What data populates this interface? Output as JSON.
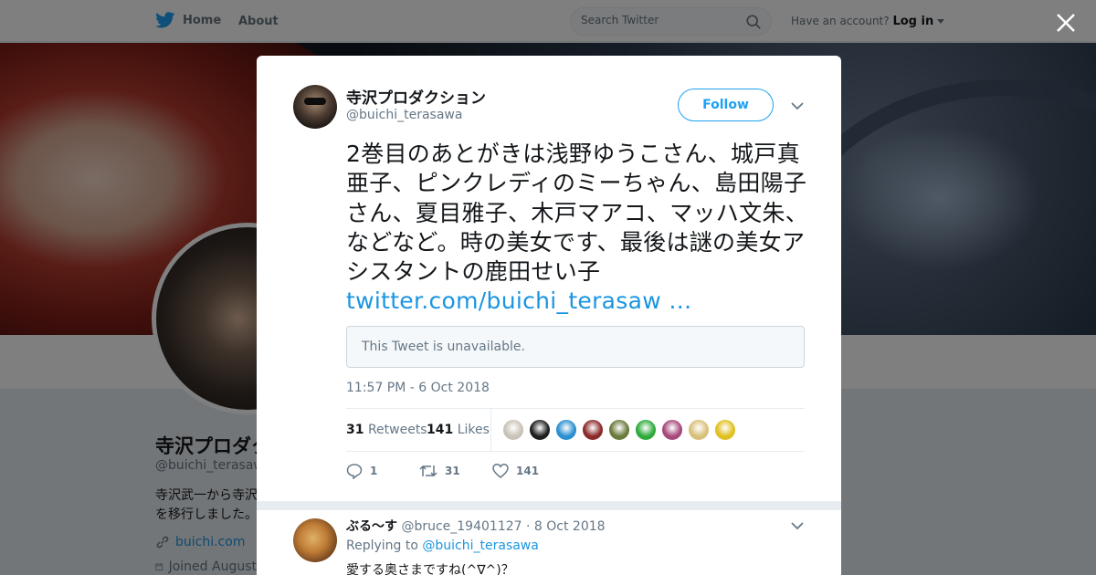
{
  "topbar": {
    "home_label": "Home",
    "about_label": "About",
    "search_placeholder": "Search Twitter",
    "have_account": "Have an account?",
    "login_label": "Log in"
  },
  "profile": {
    "name": "寺沢プロダクション",
    "handle": "@buichi_terasawa",
    "bio_line1": "寺沢武一から寺沢",
    "bio_line2": "を移行しました。",
    "url": "buichi.com",
    "joined": "Joined August"
  },
  "tweet": {
    "author_name": "寺沢プロダクション",
    "author_handle": "@buichi_terasawa",
    "follow_label": "Follow",
    "text": "2巻目のあとがきは浅野ゆうこさん、城戸真亜子、ピンクレディのミーちゃん、島田陽子さん、夏目雅子、木戸マアコ、マッハ文朱、などなど。時の美女です、最後は謎の美女アシスタントの鹿田せい子 ",
    "link": "twitter.com/buichi_terasaw …",
    "quoted_unavailable": "This Tweet is unavailable.",
    "timestamp": "11:57 PM - 6 Oct 2018",
    "retweets_count": "31",
    "retweets_label": "Retweets",
    "likes_count": "141",
    "likes_label": "Likes",
    "reply_count": "1",
    "retweet_count_action": "31",
    "like_count_action": "141"
  },
  "reply": {
    "name": "ぶる～す",
    "handle": "@bruce_19401127",
    "date": "· 8 Oct 2018",
    "replying_to_label": "Replying to",
    "replying_to_handle": "@buichi_terasawa",
    "text": "愛する奥さまですね(^∇^)？"
  },
  "likers": [
    {
      "icon": "avatar",
      "color": "#c9c2b6"
    },
    {
      "icon": "avatar",
      "color": "#1e1e1e"
    },
    {
      "icon": "avatar",
      "color": "#2a8fd0"
    },
    {
      "icon": "avatar",
      "color": "#8b2a2a"
    },
    {
      "icon": "avatar",
      "color": "#6a7a3a"
    },
    {
      "icon": "avatar",
      "color": "#2faa3a"
    },
    {
      "icon": "avatar",
      "color": "#a6487a"
    },
    {
      "icon": "avatar",
      "color": "#d8c07a"
    },
    {
      "icon": "avatar",
      "color": "#e0c020"
    }
  ],
  "colors": {
    "accent": "#1da1f2",
    "link": "#1b95e0"
  }
}
